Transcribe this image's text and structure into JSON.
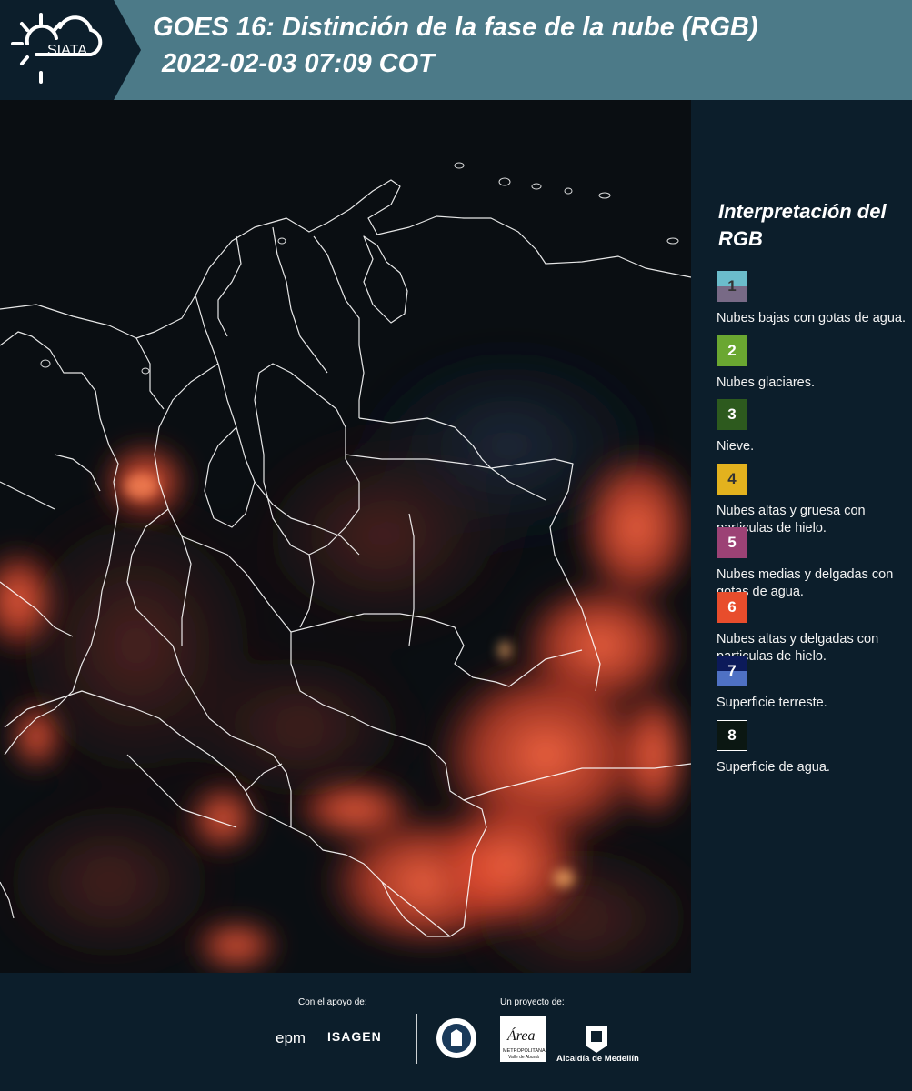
{
  "header": {
    "logo_text": "SIATA",
    "title_line1": "GOES 16: Distinción de la fase de la nube (RGB)",
    "title_line2": "2022-02-03 07:09 COT"
  },
  "colors": {
    "header_bg": "#4c7a88",
    "panel_bg": "#0c1e2b",
    "map_bg": "#0a0e12",
    "cloud_orange": "#e84d2c",
    "border_white": "#ffffff"
  },
  "legend": {
    "title": "Interpretación del RGB",
    "items": [
      {
        "num": "1",
        "label": "Nubes bajas con gotas de agua.",
        "color_top": "#6bbccb",
        "color_bottom": "#786a86",
        "num_color": "#333333"
      },
      {
        "num": "2",
        "label": "Nubes glaciares.",
        "color_top": "#6aa731",
        "color_bottom": "#6aa731",
        "num_color": "#ffffff"
      },
      {
        "num": "3",
        "label": "Nieve.",
        "color_top": "#2d5a1e",
        "color_bottom": "#2d5a1e",
        "num_color": "#ffffff"
      },
      {
        "num": "4",
        "label": "Nubes altas y gruesa con particulas de hielo.",
        "color_top": "#e3b21e",
        "color_bottom": "#e3b21e",
        "num_color": "#333333"
      },
      {
        "num": "5",
        "label": "Nubes medias y delgadas con gotas de agua.",
        "color_top": "#9c4275",
        "color_bottom": "#9c4275",
        "num_color": "#ffffff"
      },
      {
        "num": "6",
        "label": "Nubes altas y delgadas con particulas de hielo.",
        "color_top": "#e84d2c",
        "color_bottom": "#e84d2c",
        "num_color": "#ffffff"
      },
      {
        "num": "7",
        "label": "Superficie terreste.",
        "color_top": "#0c1a5a",
        "color_bottom": "#4f71c4",
        "num_color": "#ffffff"
      },
      {
        "num": "8",
        "label": "Superficie de agua.",
        "color_top": "#0b1712",
        "color_bottom": "#0b1712",
        "num_color": "#ffffff"
      }
    ]
  },
  "footer": {
    "support_label": "Con el apoyo de:",
    "project_label": "Un proyecto de:",
    "epm_logo": "epm",
    "isagen_logo": "ISAGEN",
    "area_logo": "Área",
    "area_sub": "METROPOLITANA",
    "area_sub2": "Valle de Aburrá",
    "alcaldia_label": "Alcaldía de Medellín"
  }
}
